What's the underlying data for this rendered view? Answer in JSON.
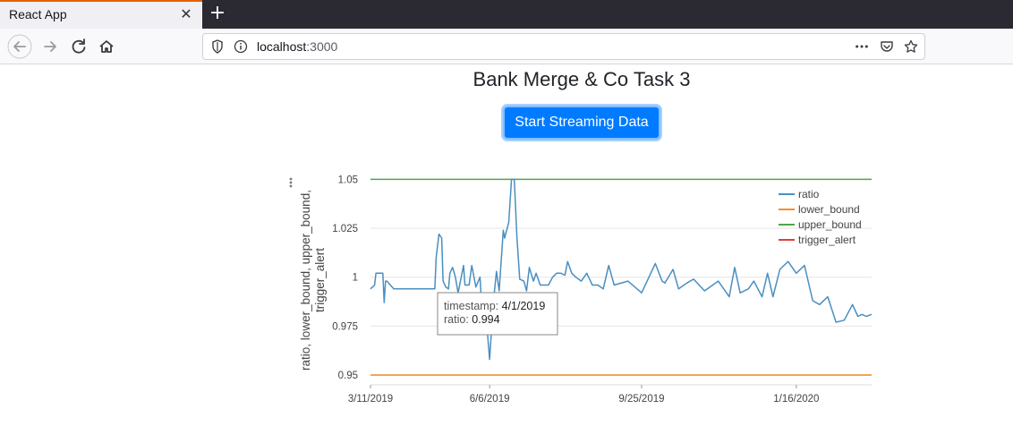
{
  "browser": {
    "tab_title": "React App",
    "url_host": "localhost",
    "url_port": ":3000"
  },
  "page": {
    "title": "Bank Merge & Co Task 3",
    "stream_button_label": "Start Streaming Data"
  },
  "tooltip": {
    "timestamp_label": "timestamp:",
    "timestamp_value": "4/1/2019",
    "ratio_label": "ratio:",
    "ratio_value": "0.994"
  },
  "colors": {
    "ratio": "#4a8fc0",
    "lower_bound": "#f4902a",
    "upper_bound": "#4ca64c",
    "trigger_alert": "#e04040"
  },
  "chart_data": {
    "type": "line",
    "title": "",
    "ylabel": "ratio, lower_bound, upper_bound, trigger_alert",
    "xlabel": "",
    "ylim": [
      0.945,
      1.052
    ],
    "yticks": [
      0.95,
      0.975,
      1,
      1.025,
      1.05
    ],
    "ytick_labels": [
      "0.95",
      "0.975",
      "1",
      "1.025",
      "1.05"
    ],
    "xticks": [
      "2019-03-11",
      "2019-06-06",
      "2019-09-25",
      "2020-01-16"
    ],
    "xtick_labels": [
      "3/11/2019",
      "6/6/2019",
      "9/25/2019",
      "1/16/2020"
    ],
    "xlim": [
      "2019-03-11",
      "2020-03-11"
    ],
    "legend": [
      "ratio",
      "lower_bound",
      "upper_bound",
      "trigger_alert"
    ],
    "legend_position": "top-right",
    "series": [
      {
        "name": "ratio",
        "x": [
          "2019-03-11",
          "2019-03-14",
          "2019-03-15",
          "2019-03-20",
          "2019-03-21",
          "2019-03-22",
          "2019-03-23",
          "2019-03-28",
          "2019-03-29",
          "2019-04-01",
          "2019-04-27",
          "2019-04-28",
          "2019-04-30",
          "2019-05-02",
          "2019-05-03",
          "2019-05-05",
          "2019-05-07",
          "2019-05-08",
          "2019-05-10",
          "2019-05-12",
          "2019-05-14",
          "2019-05-18",
          "2019-05-19",
          "2019-05-22",
          "2019-05-24",
          "2019-05-27",
          "2019-05-30",
          "2019-06-01",
          "2019-06-04",
          "2019-06-06",
          "2019-06-09",
          "2019-06-11",
          "2019-06-13",
          "2019-06-16",
          "2019-06-17",
          "2019-06-20",
          "2019-06-22",
          "2019-06-24",
          "2019-06-26",
          "2019-06-28",
          "2019-07-01",
          "2019-07-03",
          "2019-07-05",
          "2019-07-08",
          "2019-07-10",
          "2019-07-13",
          "2019-07-15",
          "2019-07-17",
          "2019-07-19",
          "2019-07-22",
          "2019-07-25",
          "2019-07-28",
          "2019-07-31",
          "2019-08-02",
          "2019-08-05",
          "2019-08-08",
          "2019-08-12",
          "2019-08-16",
          "2019-08-20",
          "2019-08-24",
          "2019-08-28",
          "2019-09-01",
          "2019-09-05",
          "2019-09-15",
          "2019-09-25",
          "2019-10-05",
          "2019-10-10",
          "2019-10-12",
          "2019-10-18",
          "2019-10-22",
          "2019-10-28",
          "2019-11-02",
          "2019-11-10",
          "2019-11-20",
          "2019-11-28",
          "2019-12-02",
          "2019-12-06",
          "2019-12-12",
          "2019-12-16",
          "2019-12-22",
          "2019-12-26",
          "2019-12-30",
          "2020-01-04",
          "2020-01-10",
          "2020-01-16",
          "2020-01-22",
          "2020-01-28",
          "2020-02-02",
          "2020-02-08",
          "2020-02-14",
          "2020-02-20",
          "2020-02-26",
          "2020-03-01",
          "2020-03-04",
          "2020-03-07",
          "2020-03-11"
        ],
        "y": [
          0.994,
          0.996,
          1.002,
          1.002,
          0.987,
          0.998,
          0.998,
          0.994,
          0.994,
          0.994,
          0.994,
          1.01,
          1.022,
          1.02,
          0.998,
          0.995,
          0.994,
          1.002,
          1.005,
          1.0,
          0.992,
          1.006,
          0.996,
          0.996,
          1.006,
          0.995,
          1.0,
          0.976,
          0.975,
          0.958,
          0.989,
          1.003,
          0.993,
          1.024,
          1.02,
          1.028,
          1.05,
          1.05,
          1.02,
          0.999,
          0.998,
          0.993,
          1.005,
          0.998,
          1.002,
          0.996,
          0.996,
          0.996,
          0.996,
          1.0,
          1.002,
          1.002,
          1.001,
          1.008,
          1.002,
          1.0,
          0.998,
          1.002,
          0.996,
          0.996,
          0.994,
          1.006,
          0.996,
          0.998,
          0.992,
          1.007,
          0.998,
          0.997,
          1.004,
          0.994,
          0.997,
          0.999,
          0.993,
          0.998,
          0.99,
          1.005,
          0.992,
          0.994,
          0.998,
          0.99,
          1.002,
          0.99,
          1.004,
          1.008,
          1.002,
          1.006,
          0.988,
          0.986,
          0.99,
          0.977,
          0.978,
          0.986,
          0.98,
          0.981,
          0.98,
          0.981
        ]
      },
      {
        "name": "lower_bound",
        "value": 0.95
      },
      {
        "name": "upper_bound",
        "value": 1.05
      },
      {
        "name": "trigger_alert",
        "value": null
      }
    ]
  }
}
